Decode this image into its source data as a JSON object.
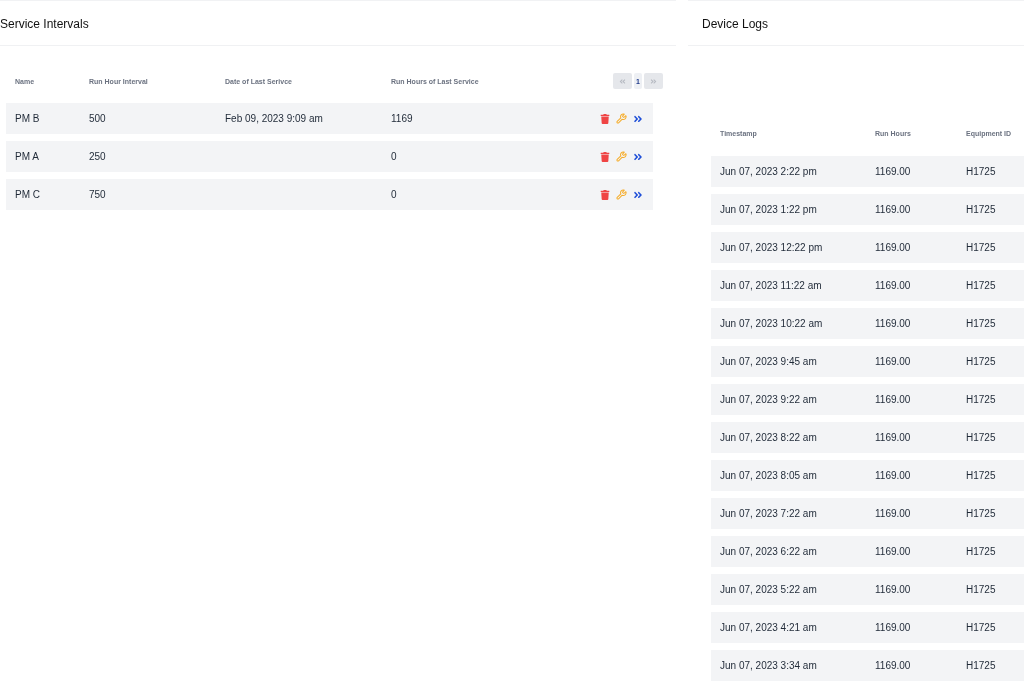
{
  "service_intervals": {
    "title": "Service Intervals",
    "columns": [
      "Name",
      "Run Hour Interval",
      "Date of Last Serivce",
      "Run Hours of Last Service"
    ],
    "pagination": {
      "prev_disabled": true,
      "pages": [
        {
          "label": "1",
          "selected": true
        }
      ],
      "next_disabled": true
    },
    "rows": [
      {
        "name": "PM B",
        "interval": "500",
        "last_date": "Feb 09, 2023 9:09 am",
        "last_hours": "1169"
      },
      {
        "name": "PM A",
        "interval": "250",
        "last_hours": "0"
      },
      {
        "name": "PM C",
        "interval": "750",
        "last_hours": "0"
      }
    ]
  },
  "device_logs": {
    "title": "Device Logs",
    "columns": [
      "Timestamp",
      "Run Hours",
      "Equipment ID"
    ],
    "rows": [
      {
        "timestamp": "Jun 07, 2023 2:22 pm",
        "run_hours": "1169.00",
        "equipment_id": "H1725"
      },
      {
        "timestamp": "Jun 07, 2023 1:22 pm",
        "run_hours": "1169.00",
        "equipment_id": "H1725"
      },
      {
        "timestamp": "Jun 07, 2023 12:22 pm",
        "run_hours": "1169.00",
        "equipment_id": "H1725"
      },
      {
        "timestamp": "Jun 07, 2023 11:22 am",
        "run_hours": "1169.00",
        "equipment_id": "H1725"
      },
      {
        "timestamp": "Jun 07, 2023 10:22 am",
        "run_hours": "1169.00",
        "equipment_id": "H1725"
      },
      {
        "timestamp": "Jun 07, 2023 9:45 am",
        "run_hours": "1169.00",
        "equipment_id": "H1725"
      },
      {
        "timestamp": "Jun 07, 2023 9:22 am",
        "run_hours": "1169.00",
        "equipment_id": "H1725"
      },
      {
        "timestamp": "Jun 07, 2023 8:22 am",
        "run_hours": "1169.00",
        "equipment_id": "H1725"
      },
      {
        "timestamp": "Jun 07, 2023 8:05 am",
        "run_hours": "1169.00",
        "equipment_id": "H1725"
      },
      {
        "timestamp": "Jun 07, 2023 7:22 am",
        "run_hours": "1169.00",
        "equipment_id": "H1725"
      },
      {
        "timestamp": "Jun 07, 2023 6:22 am",
        "run_hours": "1169.00",
        "equipment_id": "H1725"
      },
      {
        "timestamp": "Jun 07, 2023 5:22 am",
        "run_hours": "1169.00",
        "equipment_id": "H1725"
      },
      {
        "timestamp": "Jun 07, 2023 4:21 am",
        "run_hours": "1169.00",
        "equipment_id": "H1725"
      },
      {
        "timestamp": "Jun 07, 2023 3:34 am",
        "run_hours": "1169.00",
        "equipment_id": "H1725"
      }
    ]
  }
}
